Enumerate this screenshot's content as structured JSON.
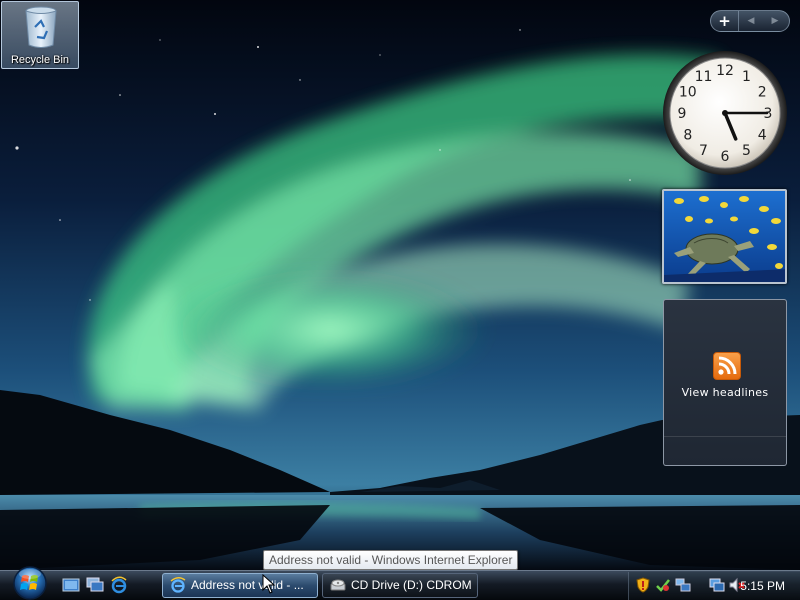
{
  "desktop": {
    "icons": [
      {
        "label": "Recycle Bin",
        "icon": "recycle-bin-icon"
      }
    ]
  },
  "sidebar": {
    "controls": {
      "add": "+",
      "prev": "◀",
      "next": "▶"
    },
    "clock_gadget": {
      "numerals": [
        "12",
        "1",
        "2",
        "3",
        "4",
        "5",
        "6",
        "7",
        "8",
        "9",
        "10",
        "11"
      ],
      "time_shown": "5:15"
    },
    "slideshow_gadget": {
      "subject": "sea turtle with fish"
    },
    "feed_gadget": {
      "label": "View headlines",
      "icon": "rss-icon"
    }
  },
  "tooltip": {
    "text": "Address not valid - Windows Internet Explorer"
  },
  "taskbar": {
    "start_icon": "windows-start-orb",
    "quick_launch": [
      "show-desktop-icon",
      "switch-windows-icon",
      "internet-explorer-icon"
    ],
    "buttons": [
      {
        "label": "Address not valid - ...",
        "icon": "internet-explorer-icon",
        "active": true
      },
      {
        "label": "CD Drive (D:) CDROM",
        "icon": "cd-drive-icon",
        "active": false
      }
    ],
    "tray": {
      "icons": [
        "security-shield-icon",
        "windows-defender-icon",
        "network-icon",
        "monitor-icon",
        "volume-muted-icon"
      ],
      "time": "5:15 PM"
    }
  },
  "colors": {
    "aurora": "#5de0a0",
    "taskbar_active": "#2c4b6e",
    "rss_orange": "#f08a2a"
  }
}
